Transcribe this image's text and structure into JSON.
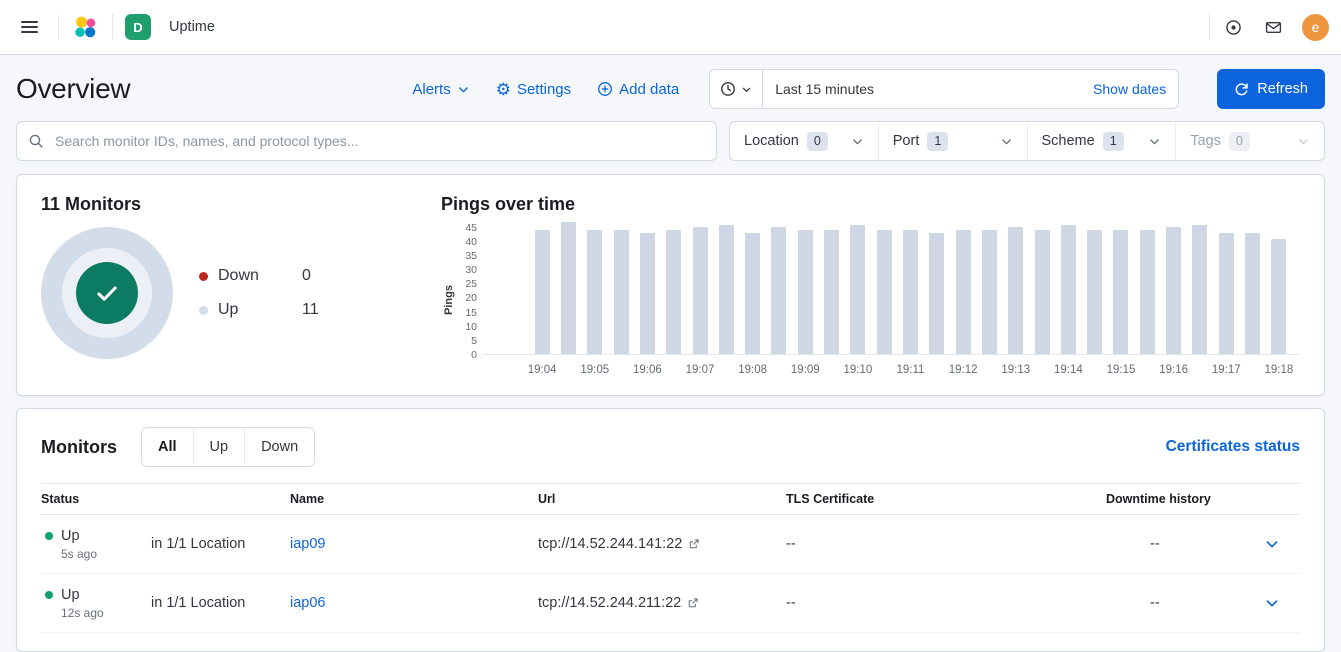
{
  "theme": {
    "primary": "#0b64dd",
    "link": "#0b64dd",
    "success": "#12a16b",
    "success_dark": "#0c7b64",
    "danger": "#bd271e",
    "bar_color": "#cfd7e5",
    "donut_ring": "#d3dce9",
    "space_badge": "#1f9e6e",
    "avatar": "#ee9540"
  },
  "topbar": {
    "space_badge": "D",
    "breadcrumb": "Uptime",
    "avatar_initial": "e"
  },
  "header": {
    "title": "Overview",
    "alerts": "Alerts",
    "settings": "Settings",
    "add_data": "Add data",
    "time_range": "Last 15 minutes",
    "show_dates": "Show dates",
    "refresh": "Refresh"
  },
  "filters": {
    "search_placeholder": "Search monitor IDs, names, and protocol types...",
    "items": [
      {
        "label": "Location",
        "count": "0",
        "disabled": false
      },
      {
        "label": "Port",
        "count": "1",
        "disabled": false
      },
      {
        "label": "Scheme",
        "count": "1",
        "disabled": false
      },
      {
        "label": "Tags",
        "count": "0",
        "disabled": true
      }
    ]
  },
  "snapshot": {
    "title": "11 Monitors",
    "legend": [
      {
        "label": "Down",
        "value": "0",
        "color": "#bd271e"
      },
      {
        "label": "Up",
        "value": "11",
        "color": "#d3dce9"
      }
    ]
  },
  "chart_data": {
    "type": "bar",
    "title": "Pings over time",
    "ylabel": "Pings",
    "xlabel": "",
    "ylim": [
      0,
      45
    ],
    "grid": false,
    "legend_position": "none",
    "yticks": [
      45,
      40,
      35,
      30,
      25,
      20,
      15,
      10,
      5,
      0
    ],
    "x_labels": [
      "19:04",
      "19:05",
      "19:06",
      "19:07",
      "19:08",
      "19:09",
      "19:10",
      "19:11",
      "19:12",
      "19:13",
      "19:14",
      "19:15",
      "19:16",
      "19:17",
      "19:18"
    ],
    "values": [
      44,
      47,
      44,
      44,
      43,
      44,
      45,
      46,
      43,
      45,
      44,
      44,
      46,
      44,
      44,
      43,
      44,
      44,
      45,
      44,
      46,
      44,
      44,
      44,
      45,
      46,
      43,
      43,
      41
    ]
  },
  "monitors": {
    "title": "Monitors",
    "tabs": [
      "All",
      "Up",
      "Down"
    ],
    "selected_tab": "All",
    "certificates_link": "Certificates status",
    "columns": [
      "Status",
      "Name",
      "Url",
      "TLS Certificate",
      "Downtime history"
    ],
    "rows": [
      {
        "status": "Up",
        "ago": "5s ago",
        "location": "in 1/1 Location",
        "name": "iap09",
        "url": "tcp://14.52.244.141:22",
        "tls": "--",
        "downtime": "--"
      },
      {
        "status": "Up",
        "ago": "12s ago",
        "location": "in 1/1 Location",
        "name": "iap06",
        "url": "tcp://14.52.244.211:22",
        "tls": "--",
        "downtime": "--"
      }
    ]
  }
}
